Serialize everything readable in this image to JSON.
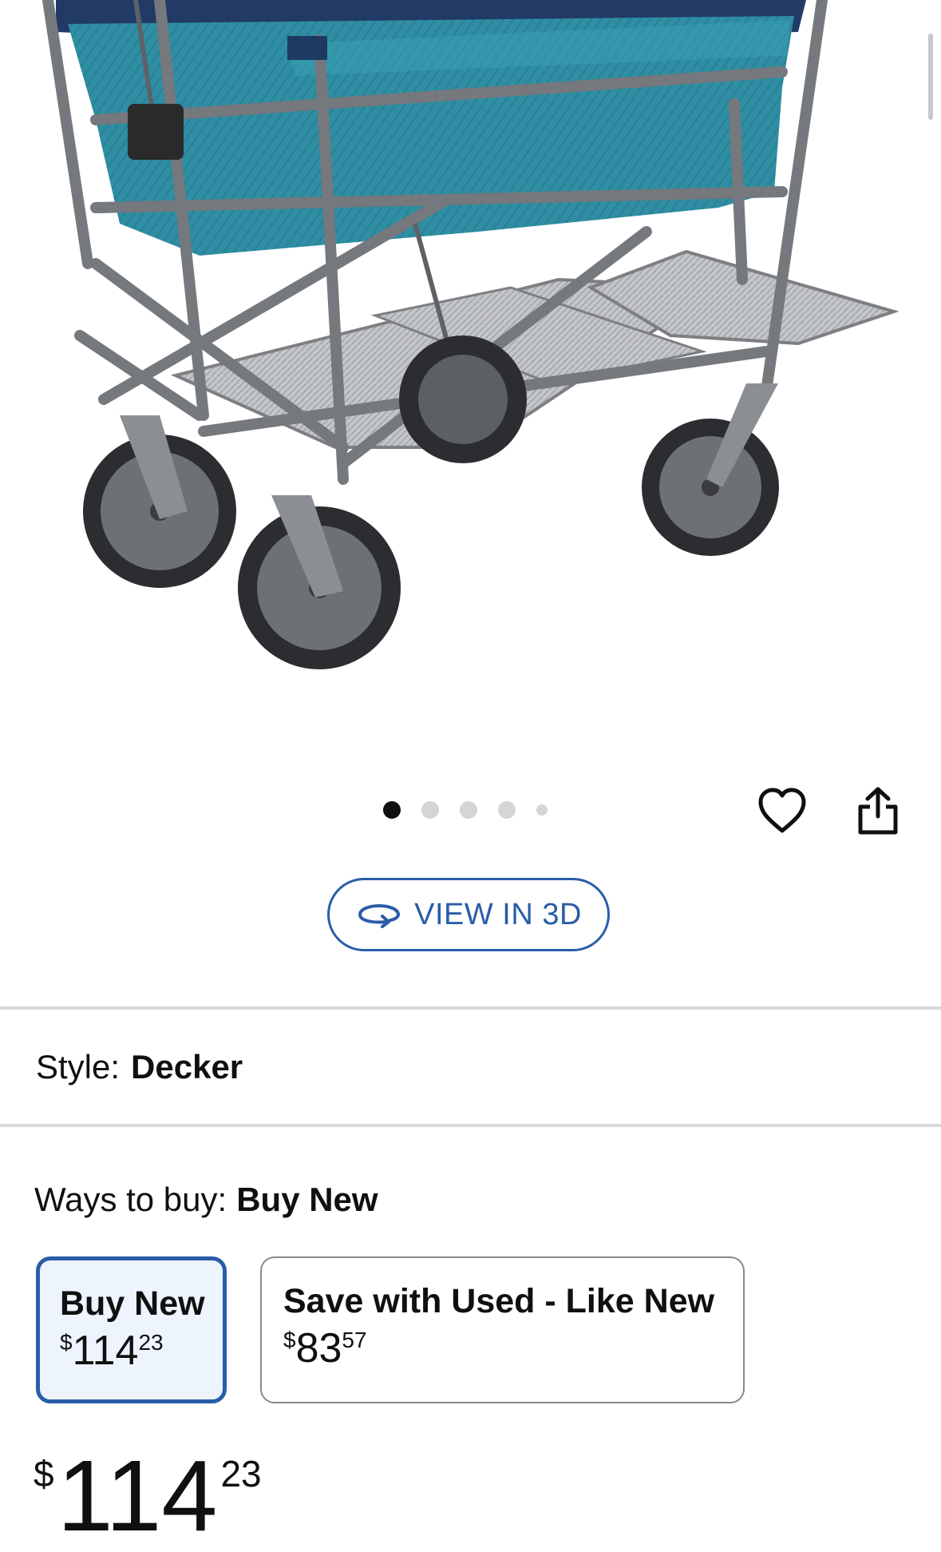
{
  "product": {
    "image_alt": "Double decker folding wagon with teal fabric and grey metal frame",
    "carousel": {
      "total": 5,
      "active": 1
    }
  },
  "actions": {
    "wishlist_icon": "heart-icon",
    "share_icon": "share-icon"
  },
  "view3d": {
    "label": "VIEW IN 3D",
    "icon": "rotate-3d-icon"
  },
  "style": {
    "label": "Style:",
    "value": "Decker"
  },
  "ways_to_buy": {
    "label": "Ways to buy:",
    "value": "Buy New",
    "options": [
      {
        "title": "Buy New",
        "currency": "$",
        "whole": "114",
        "cents": "23",
        "selected": true
      },
      {
        "title": "Save with Used - Like New",
        "currency": "$",
        "whole": "83",
        "cents": "57",
        "selected": false
      }
    ]
  },
  "price": {
    "currency": "$",
    "whole": "114",
    "cents": "23"
  },
  "colors": {
    "accent": "#2a5da8",
    "selected_bg": "#edf4fd",
    "fabric": "#2f8ea3",
    "frame": "#7d7f82"
  }
}
